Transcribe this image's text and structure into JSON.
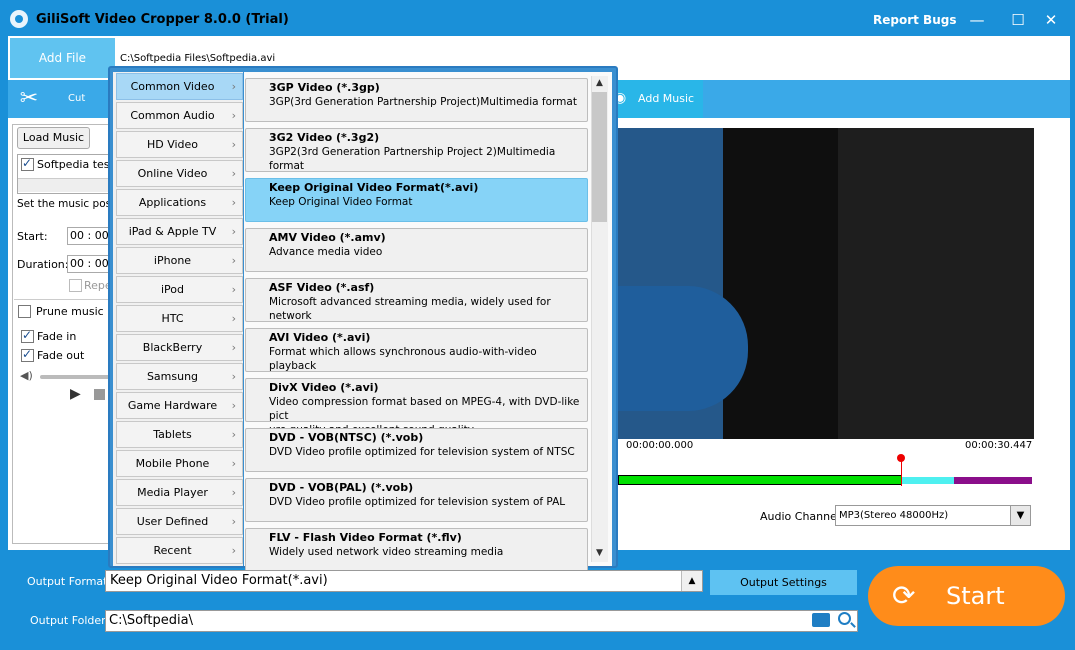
{
  "window": {
    "title": "GiliSoft Video Cropper 8.0.0 (Trial)",
    "report_bugs": "Report Bugs",
    "minimize": "—",
    "maximize": "☐",
    "close": "✕"
  },
  "toolbar": {
    "add_file": "Add File",
    "file_path": "C:\\Softpedia Files\\Softpedia.avi",
    "cut_label": "Cut",
    "add_music": "Add Music"
  },
  "music_panel": {
    "load_music": "Load Music",
    "track_name": "Softpedia test.",
    "set_position_text": "Set the music posit",
    "start_label": "Start:",
    "start_value": "00 : 00",
    "duration_label": "Duration:",
    "duration_value": "00 : 00",
    "repeat_label": "Repe",
    "prune_music": "Prune music",
    "fade_in": "Fade in",
    "fade_out": "Fade out"
  },
  "preview": {
    "time_start": "00:00:00.000",
    "time_end": "00:00:30.447",
    "audio_channel_label": "Audio Channel:",
    "audio_channel_value": "MP3(Stereo 48000Hz)"
  },
  "format_menu": {
    "categories": [
      {
        "label": "Common Video",
        "selected": true
      },
      {
        "label": "Common Audio"
      },
      {
        "label": "HD Video"
      },
      {
        "label": "Online Video"
      },
      {
        "label": "Applications"
      },
      {
        "label": "iPad & Apple TV"
      },
      {
        "label": "iPhone"
      },
      {
        "label": "iPod"
      },
      {
        "label": "HTC"
      },
      {
        "label": "BlackBerry"
      },
      {
        "label": "Samsung"
      },
      {
        "label": "Game Hardware"
      },
      {
        "label": "Tablets"
      },
      {
        "label": "Mobile Phone"
      },
      {
        "label": "Media Player"
      },
      {
        "label": "User Defined"
      },
      {
        "label": "Recent"
      }
    ],
    "formats": [
      {
        "title": "3GP Video (*.3gp)",
        "desc": "3GP(3rd Generation Partnership Project)Multimedia format"
      },
      {
        "title": "3G2 Video (*.3g2)",
        "desc": "3GP2(3rd Generation Partnership Project 2)Multimedia format"
      },
      {
        "title": "Keep Original Video Format(*.avi)",
        "desc": "Keep Original Video Format",
        "selected": true
      },
      {
        "title": "AMV Video (*.amv)",
        "desc": "Advance media video"
      },
      {
        "title": "ASF Video (*.asf)",
        "desc": "Microsoft advanced streaming media, widely used for network"
      },
      {
        "title": "AVI Video (*.avi)",
        "desc": "Format which allows synchronous audio-with-video playback"
      },
      {
        "title": "DivX Video (*.avi)",
        "desc": "Video compression format based on MPEG-4, with DVD-like pict",
        "desc2": "ure quality and excellent sound quality."
      },
      {
        "title": "DVD - VOB(NTSC) (*.vob)",
        "desc": "DVD Video profile optimized for television system of NTSC"
      },
      {
        "title": "DVD - VOB(PAL) (*.vob)",
        "desc": "DVD Video profile optimized for television system of PAL"
      },
      {
        "title": "FLV - Flash Video Format (*.flv)",
        "desc": "Widely used network video streaming media"
      }
    ]
  },
  "output": {
    "format_label": "Output Format:",
    "format_value": "Keep Original Video Format(*.avi)",
    "settings_button": "Output Settings",
    "folder_label": "Output Folder:",
    "folder_value": "C:\\Softpedia\\",
    "start_button": "Start"
  }
}
